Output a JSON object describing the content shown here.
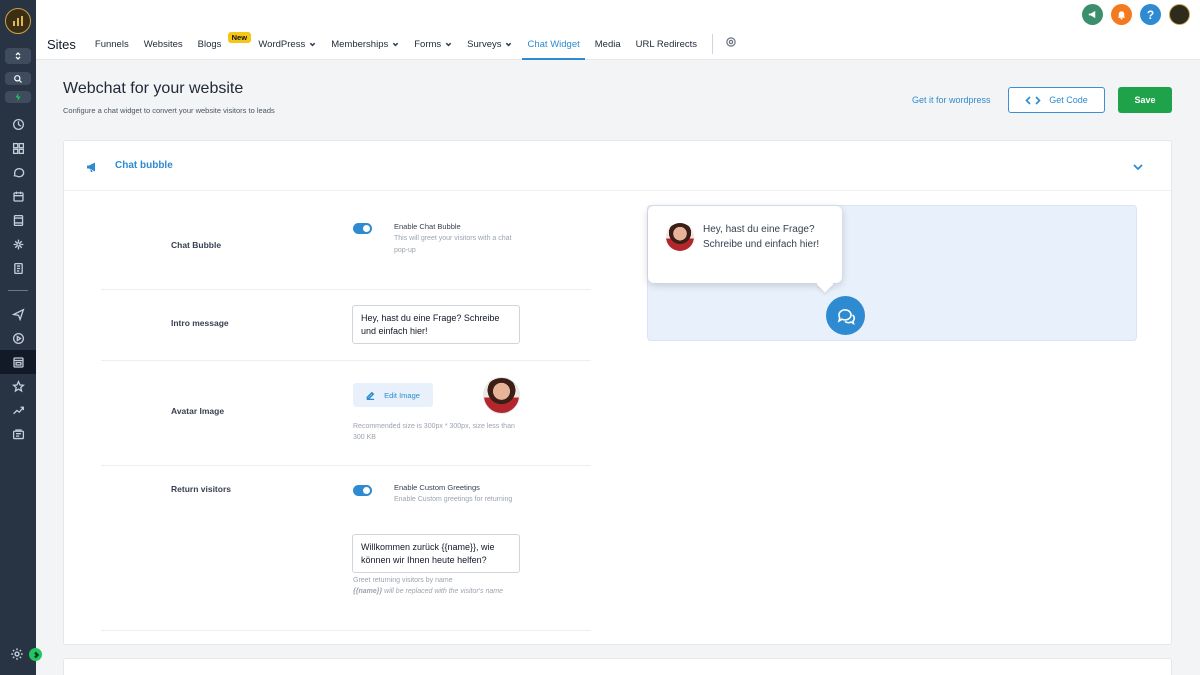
{
  "nav": {
    "title": "Sites",
    "items": [
      "Funnels",
      "Websites",
      "Blogs",
      "WordPress",
      "Memberships",
      "Forms",
      "Surveys",
      "Chat Widget",
      "Media",
      "URL Redirects"
    ],
    "blogs_badge": "New",
    "active": "Chat Widget"
  },
  "topbar": {
    "help_label": "?"
  },
  "header": {
    "title": "Webchat for your website",
    "subtitle": "Configure a chat widget to convert your website visitors to leads",
    "wp_link": "Get it for wordpress",
    "get_code": "Get Code",
    "save": "Save"
  },
  "section": {
    "title": "Chat bubble",
    "chat_bubble": {
      "label": "Chat Bubble",
      "toggle_title": "Enable Chat Bubble",
      "toggle_desc": "This will greet your visitors with a chat pop-up",
      "enabled": true
    },
    "intro": {
      "label": "Intro message",
      "value": "Hey, hast du eine Frage? Schreibe und einfach hier!"
    },
    "avatar": {
      "label": "Avatar Image",
      "edit_label": "Edit Image",
      "note": "Recommended size is 300px * 300px, size less than 300 KB"
    },
    "return_visitors": {
      "label": "Return visitors",
      "toggle_title": "Enable Custom Greetings",
      "toggle_desc": "Enable Custom greetings for returning",
      "enabled": true,
      "value": "Willkommen zurück {{name}}, wie können wir Ihnen heute helfen?",
      "note_1": "Greet returning visitors by name",
      "note_2_code": "{{name}}",
      "note_2_rest": " will be replaced with the visitor's name"
    }
  },
  "preview": {
    "message": "Hey, hast du eine Frage? Schreibe und einfach hier!"
  },
  "colors": {
    "accent": "#2e8bd1",
    "save": "#1fa34a",
    "sidebar": "#283444"
  }
}
